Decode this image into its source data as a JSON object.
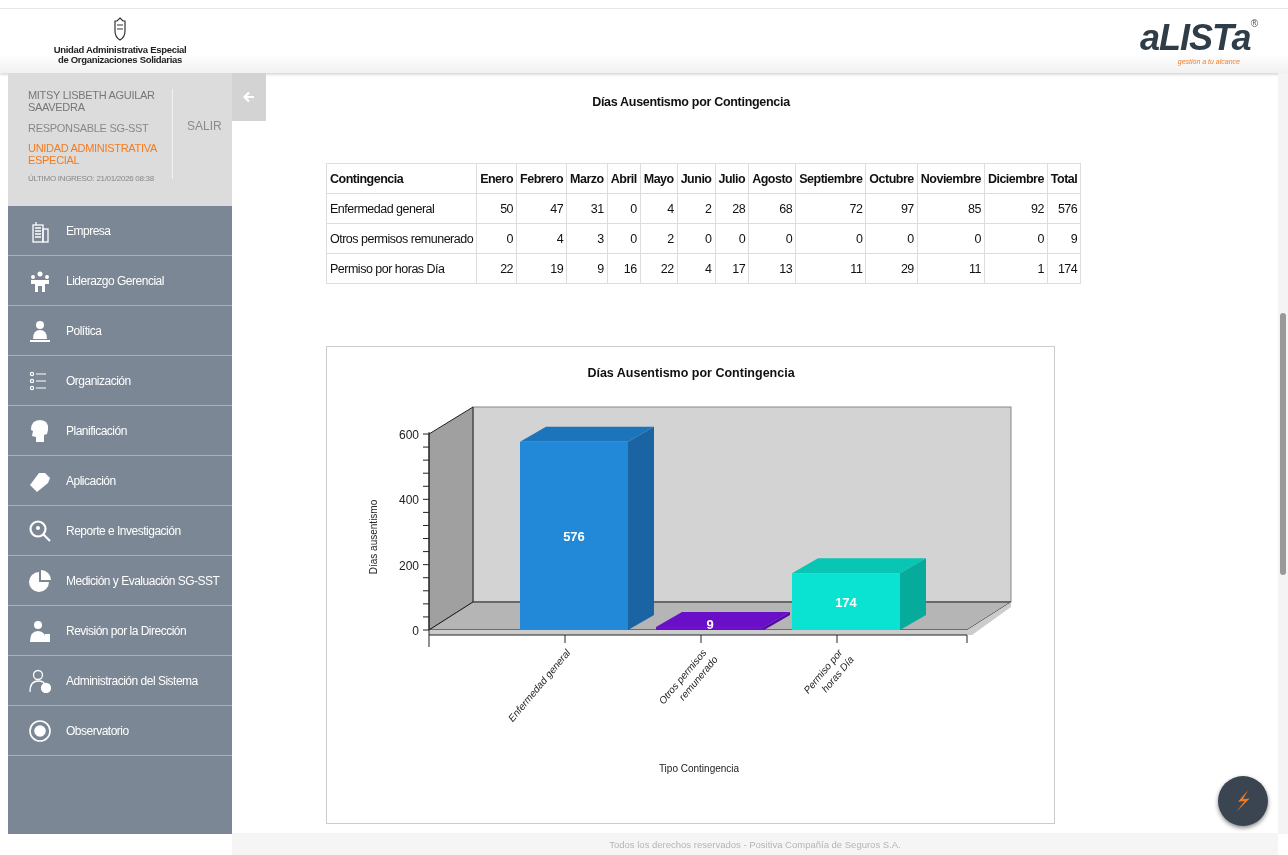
{
  "header": {
    "org_name": [
      "Unidad Administrativa Especial",
      "de Organizaciones Solidarias"
    ],
    "logo_text": "aLISTa",
    "logo_registered": "®",
    "logo_tagline": "gestión a tu alcance"
  },
  "user": {
    "name": "MITSY LISBETH AGUILAR SAAVEDRA",
    "role": "RESPONSABLE SG-SST",
    "entity": "UNIDAD ADMINISTRATIVA ESPECIAL",
    "last_login": "ÚLTIMO INGRESO: 21/01/2026 08:38",
    "logout": "SALIR"
  },
  "sidebar": {
    "items": [
      {
        "label": "Empresa"
      },
      {
        "label": "Liderazgo Gerencial"
      },
      {
        "label": "Política"
      },
      {
        "label": "Organización"
      },
      {
        "label": "Planificación"
      },
      {
        "label": "Aplicación"
      },
      {
        "label": "Reporte e Investigación"
      },
      {
        "label": "Medición y Evaluación SG-SST"
      },
      {
        "label": "Revisión por la Dirección"
      },
      {
        "label": "Administración del Sistema"
      },
      {
        "label": "Observatorio"
      }
    ]
  },
  "page_title": "Días Ausentismo por Contingencia",
  "table": {
    "columns": [
      "Contingencia",
      "Enero",
      "Febrero",
      "Marzo",
      "Abril",
      "Mayo",
      "Junio",
      "Julio",
      "Agosto",
      "Septiembre",
      "Octubre",
      "Noviembre",
      "Diciembre",
      "Total"
    ],
    "rows": [
      [
        "Enfermedad general",
        "50",
        "47",
        "31",
        "0",
        "4",
        "2",
        "28",
        "68",
        "72",
        "97",
        "85",
        "92",
        "576"
      ],
      [
        "Otros permisos remunerado",
        "0",
        "4",
        "3",
        "0",
        "2",
        "0",
        "0",
        "0",
        "0",
        "0",
        "0",
        "0",
        "9"
      ],
      [
        "Permiso por horas Día",
        "22",
        "19",
        "9",
        "16",
        "22",
        "4",
        "17",
        "13",
        "11",
        "29",
        "11",
        "1",
        "174"
      ]
    ]
  },
  "chart": {
    "chart_data": {
      "type": "bar",
      "title": "Días Ausentismo por Contingencia",
      "xlabel": "Tipo Contingencia",
      "ylabel": "Días ausentismo",
      "categories": [
        "Enfermedad general",
        "Otros permisos remunerado",
        "Permiso por horas Día"
      ],
      "values": [
        576,
        9,
        174
      ],
      "ylim": [
        0,
        600
      ],
      "yticks": [
        0,
        200,
        400,
        600
      ],
      "value_labels": [
        "576",
        "9",
        "174"
      ]
    }
  },
  "footer": "Todos los derechos reservados - Positiva Compañía de Seguros S.A."
}
